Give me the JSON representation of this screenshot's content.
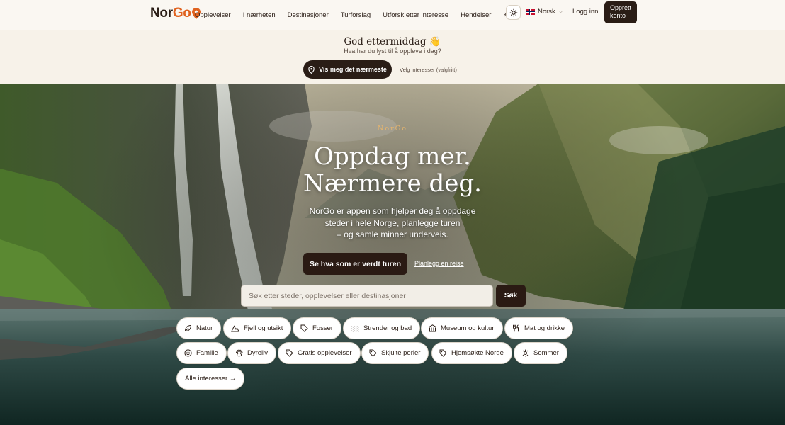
{
  "nav": {
    "logo_nor": "Nor",
    "logo_go": "Go",
    "links": [
      "Opplevelser",
      "I nærheten",
      "Destinasjoner",
      "Turforslag",
      "Utforsk etter interesse",
      "Hendelser",
      "Kart"
    ],
    "language": "Norsk",
    "login": "Logg inn",
    "signup_line1": "Opprett",
    "signup_line2": "konto"
  },
  "greeting": {
    "title": "God ettermiddag 👋",
    "subtitle": "Hva har du lyst til å oppleve i dag?",
    "nearest_button": "Vis meg det nærmeste",
    "choose_interests": "Velg interesser (valgfritt)"
  },
  "hero": {
    "brand": "NorGo",
    "headline_line1": "Oppdag mer.",
    "headline_line2": "Nærmere deg.",
    "lead_line1": "NorGo er appen som hjelper deg å oppdage",
    "lead_line2": "steder i hele Norge, planlegge turen",
    "lead_line3": "– og samle minner underveis.",
    "cta": "Se hva som er verdt turen",
    "plan_link": "Planlegg en reise"
  },
  "search": {
    "placeholder": "Søk etter steder, opplevelser eller destinasjoner",
    "button": "Søk"
  },
  "chips": [
    {
      "label": "Natur",
      "icon": "leaf-icon"
    },
    {
      "label": "Fjell og utsikt",
      "icon": "mountain-icon"
    },
    {
      "label": "Fosser",
      "icon": "tag-icon"
    },
    {
      "label": "Strender og bad",
      "icon": "waves-icon"
    },
    {
      "label": "Museum og kultur",
      "icon": "museum-icon"
    },
    {
      "label": "Mat og drikke",
      "icon": "utensils-icon"
    },
    {
      "label": "Familie",
      "icon": "smile-icon"
    },
    {
      "label": "Dyreliv",
      "icon": "paw-icon"
    },
    {
      "label": "Gratis opplevelser",
      "icon": "tag-icon"
    },
    {
      "label": "Skjulte perler",
      "icon": "tag-icon"
    },
    {
      "label": "Hjemsøkte Norge",
      "icon": "tag-icon"
    },
    {
      "label": "Sommer",
      "icon": "sun-icon"
    }
  ],
  "all_interests": "Alle interesser →",
  "colors": {
    "brand_dark": "#2a1d16",
    "accent_orange": "#e0621f",
    "background": "#f7f2e9"
  }
}
